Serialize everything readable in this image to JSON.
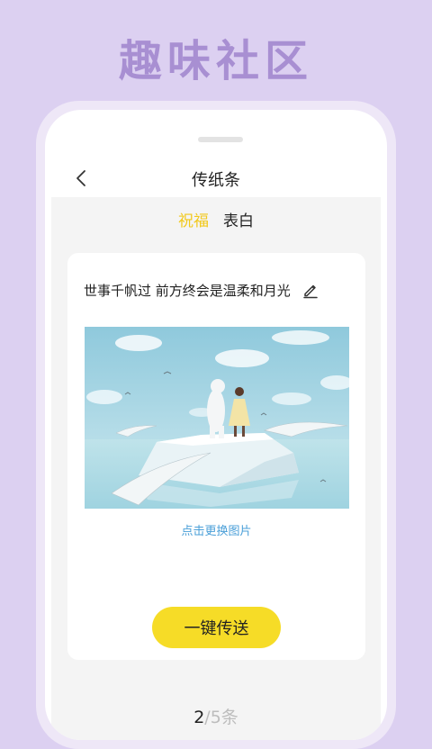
{
  "promo": {
    "title": "趣味社区"
  },
  "nav": {
    "title": "传纸条"
  },
  "tabs": [
    {
      "label": "祝福",
      "active": true
    },
    {
      "label": "表白",
      "active": false
    }
  ],
  "card": {
    "message": "世事千帆过 前方终会是温柔和月光",
    "change_image_label": "点击更换图片",
    "send_label": "一键传送"
  },
  "pager": {
    "current": "2",
    "separator": "/",
    "total_label": "5条"
  },
  "colors": {
    "accent": "#f6dc27",
    "active_tab": "#f2c91c",
    "link": "#4a9fd8",
    "background": "#dcd0f1"
  },
  "icons": {
    "back": "chevron-left-icon",
    "edit": "pencil-icon"
  }
}
